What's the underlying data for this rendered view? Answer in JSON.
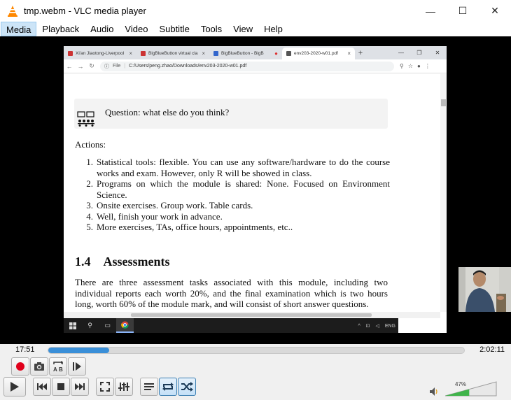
{
  "window": {
    "title": "tmp.webm - VLC media player",
    "controls": {
      "minimize": "—",
      "maximize": "☐",
      "close": "✕"
    }
  },
  "menu": [
    {
      "key": "M",
      "rest": "edia"
    },
    {
      "key": "P",
      "rest": "layback",
      "pre": ""
    },
    {
      "key": "A",
      "rest": "udio"
    },
    {
      "key": "V",
      "rest": "ideo"
    },
    {
      "key": "",
      "rest": "Subtitle",
      "ul": "S"
    },
    {
      "key": "",
      "rest": "Tools",
      "ul": "T"
    },
    {
      "key": "V",
      "rest": "iew"
    },
    {
      "key": "H",
      "rest": "elp"
    }
  ],
  "menu_labels": [
    "Media",
    "Playback",
    "Audio",
    "Video",
    "Subtitle",
    "Tools",
    "View",
    "Help"
  ],
  "browser": {
    "tabs": [
      {
        "label": "Xi'an Jiaotong-Liverpool",
        "fav": "#cc3333"
      },
      {
        "label": "BigBlueButton virtual cla",
        "fav": "#cc3333"
      },
      {
        "label": "BigBlueButton - BigB",
        "fav": "#3366cc"
      },
      {
        "label": "env203-2020-w01.pdf",
        "fav": "#555555",
        "active": true
      }
    ],
    "new_tab": "+",
    "address_label": "File",
    "url": "C:/Users/peng.zhao/Downloads/env203-2020-w01.pdf"
  },
  "pdf": {
    "question": "Question: what else do you think?",
    "actions_label": "Actions:",
    "items": [
      {
        "n": "1.",
        "text": "Statistical tools: flexible. You can use any software/hardware to do the course works and exam. However, only R will be showed in class."
      },
      {
        "n": "2.",
        "text": "Programs on which the module is shared: None. Focused on Environment Science."
      },
      {
        "n": "3.",
        "text": "Onsite exercises. Group work. Table cards."
      },
      {
        "n": "4.",
        "text": "Well, finish your work in advance."
      },
      {
        "n": "5.",
        "text": "More exercises, TAs, office hours, appointments, etc.."
      }
    ],
    "section_number": "1.4",
    "section_title": "Assessments",
    "paragraph": "There are three assessment tasks associated with this module, including two individual reports each worth 20%, and the final examination which is two hours long, worth 60% of the module mark, and will consist of short answer questions."
  },
  "taskbar": {
    "tray_text": "ENG"
  },
  "player": {
    "elapsed": "17:51",
    "total": "2:02:11",
    "progress": 0.147,
    "volume_pct": "47%",
    "volume": 0.47
  },
  "colors": {
    "seek_fill": "#3a8fd8",
    "record": "#e0001b",
    "volume_fill": "#3fb44a"
  }
}
